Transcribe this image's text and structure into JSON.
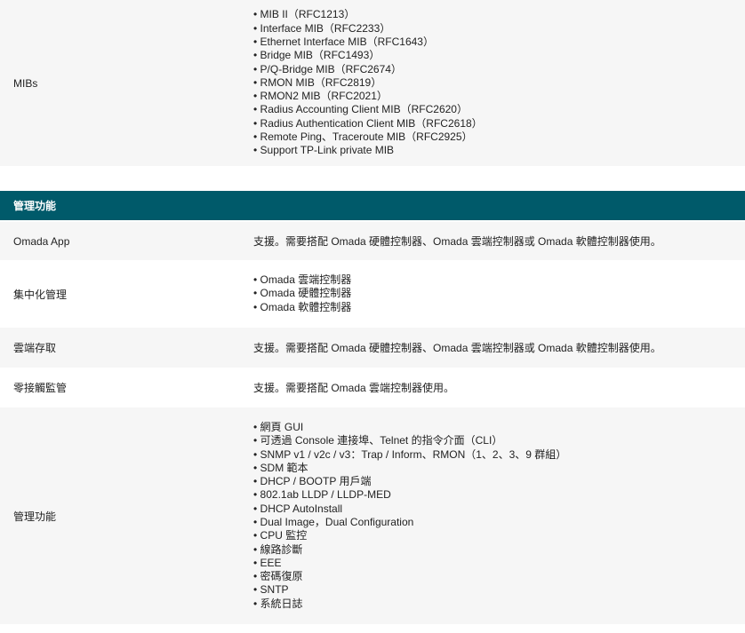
{
  "mibs": {
    "label": "MIBs",
    "items": [
      "MIB II（RFC1213）",
      "Interface MIB（RFC2233）",
      "Ethernet Interface MIB（RFC1643）",
      "Bridge MIB（RFC1493）",
      "P/Q-Bridge MIB（RFC2674）",
      "RMON MIB（RFC2819）",
      "RMON2 MIB（RFC2021）",
      "Radius Accounting Client MIB（RFC2620）",
      "Radius Authentication Client MIB（RFC2618）",
      "Remote Ping、Traceroute MIB（RFC2925）",
      "Support TP-Link private MIB"
    ]
  },
  "section": {
    "title": "管理功能"
  },
  "rows": {
    "omada_app": {
      "label": "Omada App",
      "value": "支援。需要搭配 Omada 硬體控制器、Omada 雲端控制器或 Omada 軟體控制器使用。"
    },
    "central": {
      "label": "集中化管理",
      "items": [
        "Omada 雲端控制器",
        "Omada 硬體控制器",
        "Omada 軟體控制器"
      ]
    },
    "cloud": {
      "label": "雲端存取",
      "value": "支援。需要搭配 Omada 硬體控制器、Omada 雲端控制器或 Omada 軟體控制器使用。"
    },
    "ztp": {
      "label": "零接觸監管",
      "value": "支援。需要搭配 Omada 雲端控制器使用。"
    },
    "management": {
      "label": "管理功能",
      "items": [
        "網頁 GUI",
        "可透過 Console 連接埠、Telnet 的指令介面（CLI）",
        "SNMP v1 / v2c / v3：Trap / Inform、RMON（1、2、3、9 群組）",
        "SDM 範本",
        "DHCP / BOOTP 用戶端",
        "802.1ab LLDP / LLDP-MED",
        "DHCP AutoInstall",
        "Dual Image，Dual Configuration",
        "CPU 監控",
        "線路診斷",
        "EEE",
        "密碼復原",
        "SNTP",
        "系統日誌"
      ]
    }
  }
}
